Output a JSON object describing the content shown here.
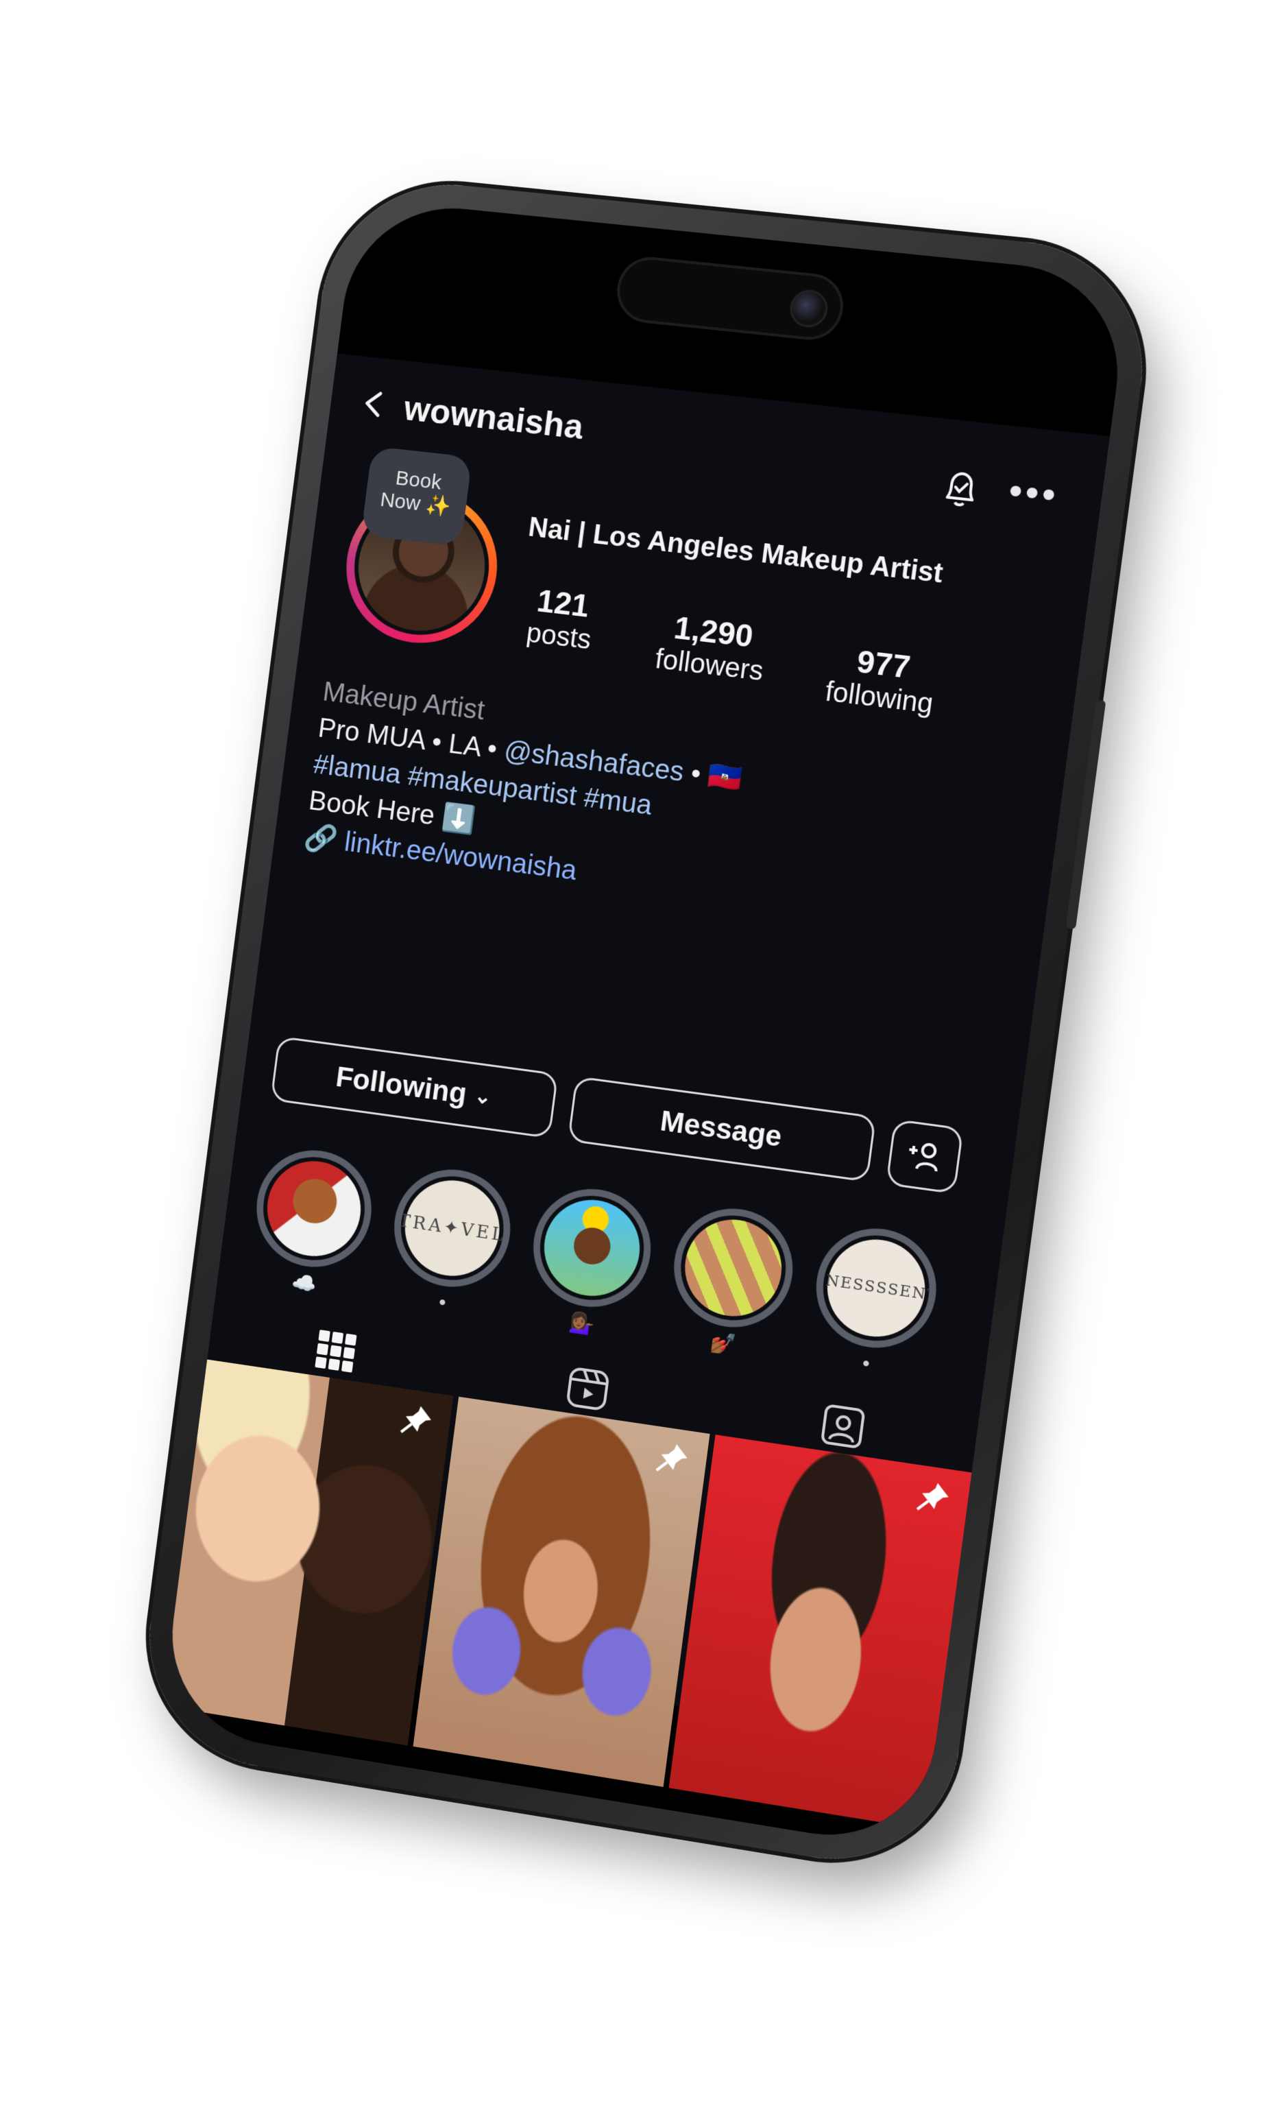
{
  "profile": {
    "username": "wownaisha",
    "badge_line1": "Book",
    "badge_line2": "Now ✨",
    "full_name": "Nai | Los Angeles Makeup Artist",
    "stats": {
      "posts_value": "121",
      "posts_label": "posts",
      "followers_value": "1,290",
      "followers_label": "followers",
      "following_value": "977",
      "following_label": "following"
    },
    "bio": {
      "category": "Makeup Artist",
      "line1_prefix": "Pro MUA • LA • ",
      "line1_mention": "@shashafaces",
      "line1_suffix": " • 🇭🇹",
      "hashtags": "#lamua #makeupartist #mua",
      "line3": "Book Here ⬇️",
      "link": "linktr.ee/wownaisha"
    }
  },
  "actions": {
    "following_label": "Following",
    "message_label": "Message"
  },
  "highlights": [
    {
      "id": "dog",
      "label": "☁️"
    },
    {
      "id": "travel",
      "word_top": "TRA",
      "word_bottom": "✦VEL",
      "label": "•"
    },
    {
      "id": "kid",
      "label": "💁🏾‍♀️"
    },
    {
      "id": "nails",
      "label": "💅🏾"
    },
    {
      "id": "fitness",
      "word_top": "FITNESS",
      "word_bottom": "SSENTIF",
      "label": "•"
    }
  ],
  "tabs": [
    "grid-icon",
    "reels-icon",
    "tagged-icon"
  ],
  "colors": {
    "background": "#0b0d12",
    "text": "#f5f5f5",
    "link": "#8fb3ff",
    "hashtag": "#a9c8f5"
  }
}
